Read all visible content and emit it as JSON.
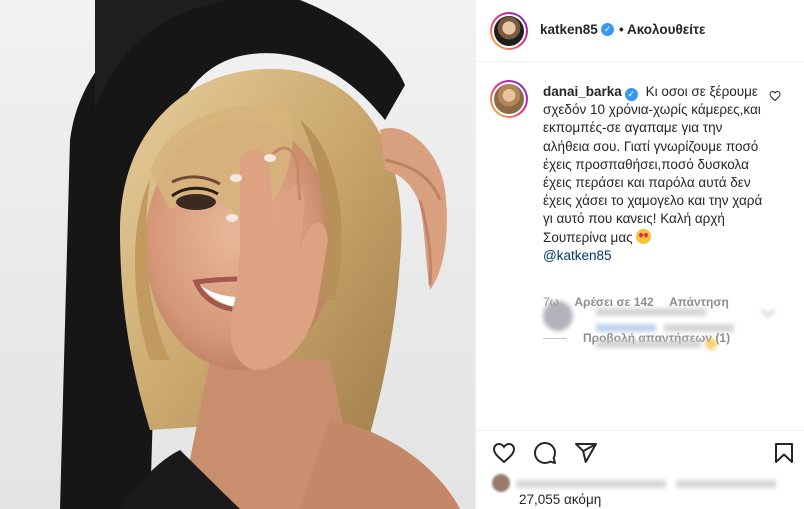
{
  "post": {
    "author": "katken85",
    "follow_label": "• Ακολουθείτε"
  },
  "comment": {
    "username": "danai_barka",
    "text": "Κι οσοι σε ξέρουμε σχεδόν 10 χρόνια-χωρίς κάμερες,και εκπομπές-σε αγαπαμε για την αλήθεια σου. Γιατί γνωρίζουμε ποσό έχεις προσπαθήσει,ποσό δυσκολα έχεις περάσει και παρόλα αυτά δεν έχεις χάσει το χαμογελο και την χαρά γι αυτό που κανεις! Καλή αρχή Σουπερίνα μας",
    "mention": "@katken85",
    "age": "7ω",
    "likes": "Αρέσει σε 142",
    "reply": "Απάντηση",
    "view_replies": "Προβολή απαντήσεων (1)"
  },
  "footer": {
    "likes_count": "27,055 ακόμη"
  },
  "colors": {
    "verified": "#3897f0",
    "mention": "#00376b",
    "muted": "#8e8e8e"
  },
  "icons": [
    "verified-badge-icon",
    "heart-icon",
    "comment-icon",
    "share-icon",
    "bookmark-icon",
    "star-eyes-emoji"
  ]
}
